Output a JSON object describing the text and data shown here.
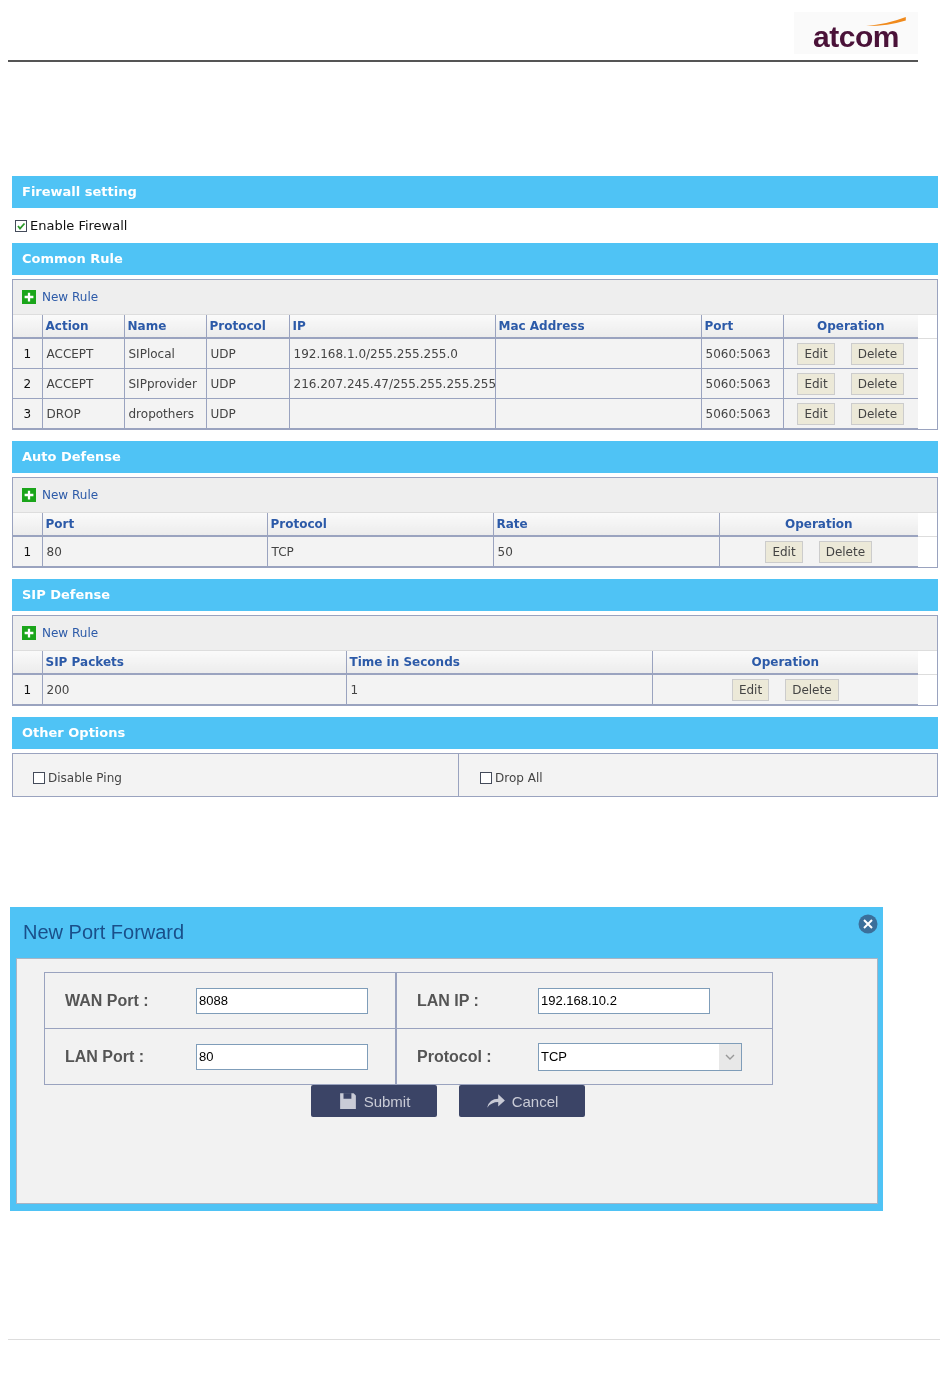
{
  "logo": "atcom",
  "firewall": {
    "title": "Firewall setting",
    "enable": {
      "label": "Enable Firewall",
      "checked": true
    }
  },
  "tables": [
    {
      "title": "Common Rule",
      "new_rule": "New Rule",
      "columns": [
        "Action",
        "Name",
        "Protocol",
        "IP",
        "Mac Address",
        "Port",
        "Operation"
      ],
      "rows": [
        {
          "index": "1",
          "cells": [
            "ACCEPT",
            "SIPlocal",
            "UDP",
            "192.168.1.0/255.255.255.0",
            "",
            "5060:5063"
          ],
          "actions": [
            "Edit",
            "Delete"
          ]
        },
        {
          "index": "2",
          "cells": [
            "ACCEPT",
            "SIPprovider",
            "UDP",
            "216.207.245.47/255.255.255.255",
            "",
            "5060:5063"
          ],
          "actions": [
            "Edit",
            "Delete"
          ]
        },
        {
          "index": "3",
          "cells": [
            "DROP",
            "dropothers",
            "UDP",
            "",
            "",
            "5060:5063"
          ],
          "actions": [
            "Edit",
            "Delete"
          ]
        }
      ]
    },
    {
      "title": "Auto Defense",
      "new_rule": "New Rule",
      "columns": [
        "Port",
        "Protocol",
        "Rate",
        "Operation"
      ],
      "rows": [
        {
          "index": "1",
          "cells": [
            "80",
            "TCP",
            "50"
          ],
          "actions": [
            "Edit",
            "Delete"
          ]
        }
      ]
    },
    {
      "title": "SIP Defense",
      "new_rule": "New Rule",
      "columns": [
        "SIP Packets",
        "Time in Seconds",
        "Operation"
      ],
      "rows": [
        {
          "index": "1",
          "cells": [
            "200",
            "1"
          ],
          "actions": [
            "Edit",
            "Delete"
          ]
        }
      ]
    }
  ],
  "other_options": {
    "title": "Other Options",
    "options": [
      {
        "label": "Disable Ping",
        "checked": false
      },
      {
        "label": "Drop All",
        "checked": false
      }
    ]
  },
  "dialog": {
    "title": "New Port Forward",
    "fields": [
      {
        "label": "WAN Port :",
        "value": "8088",
        "kind": "text"
      },
      {
        "label": "LAN IP :",
        "value": "192.168.10.2",
        "kind": "text"
      },
      {
        "label": "LAN Port :",
        "value": "80",
        "kind": "text"
      },
      {
        "label": "Protocol :",
        "value": "TCP",
        "kind": "select"
      }
    ],
    "buttons": [
      {
        "label": "Submit",
        "kind": "submit"
      },
      {
        "label": "Cancel",
        "kind": "cancel"
      }
    ]
  }
}
